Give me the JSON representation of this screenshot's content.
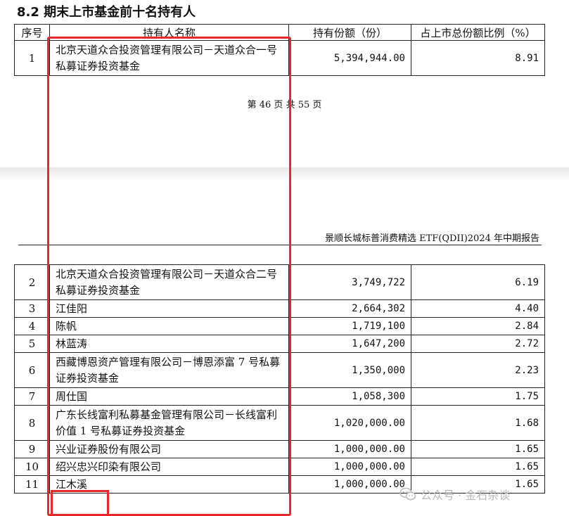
{
  "section_title": "8.2 期末上市基金前十名持有人",
  "columns": {
    "no": "序号",
    "name": "持有人名称",
    "shares": "持有份额（份）",
    "pct": "占上市总份额比例（%）"
  },
  "page_number": "第 46 页 共 55 页",
  "report_header": "景顺长城标普消费精选 ETF(QDII)2024 年中期报告",
  "rows": [
    {
      "no": "1",
      "name": "北京天道众合投资管理有限公司－天道众合一号私募证券投资基金",
      "shares": "5,394,944.00",
      "pct": "8.91"
    },
    {
      "no": "2",
      "name": "北京天道众合投资管理有限公司－天道众合二号私募证券投资基金",
      "shares": "3,749,722",
      "pct": "6.19"
    },
    {
      "no": "3",
      "name": "江佳阳",
      "shares": "2,664,302",
      "pct": "4.40"
    },
    {
      "no": "4",
      "name": "陈帆",
      "shares": "1,719,100",
      "pct": "2.84"
    },
    {
      "no": "5",
      "name": "林蓝涛",
      "shares": "1,647,200",
      "pct": "2.72"
    },
    {
      "no": "6",
      "name": "西藏博恩资产管理有限公司－博恩添富 7 号私募证券投资基金",
      "shares": "1,350,000",
      "pct": "2.23"
    },
    {
      "no": "7",
      "name": "周仕国",
      "shares": "1,058,300",
      "pct": "1.75"
    },
    {
      "no": "8",
      "name": "广东长线富利私募基金管理有限公司－长线富利价值 1 号私募证券投资基金",
      "shares": "1,020,000.00",
      "pct": "1.68"
    },
    {
      "no": "9",
      "name": "兴业证券股份有限公司",
      "shares": "1,000,000.00",
      "pct": "1.65"
    },
    {
      "no": "10",
      "name": "绍兴忠兴印染有限公司",
      "shares": "1,000,000.00",
      "pct": "1.65"
    },
    {
      "no": "11",
      "name": "江木溪",
      "shares": "1,000,000.00",
      "pct": "1.65"
    }
  ],
  "watermark": {
    "text": "公众号 · 金石杂谈",
    "icon": "wechat-icon",
    "color": "#b9b9b9"
  },
  "highlight_color": "#e8282b"
}
